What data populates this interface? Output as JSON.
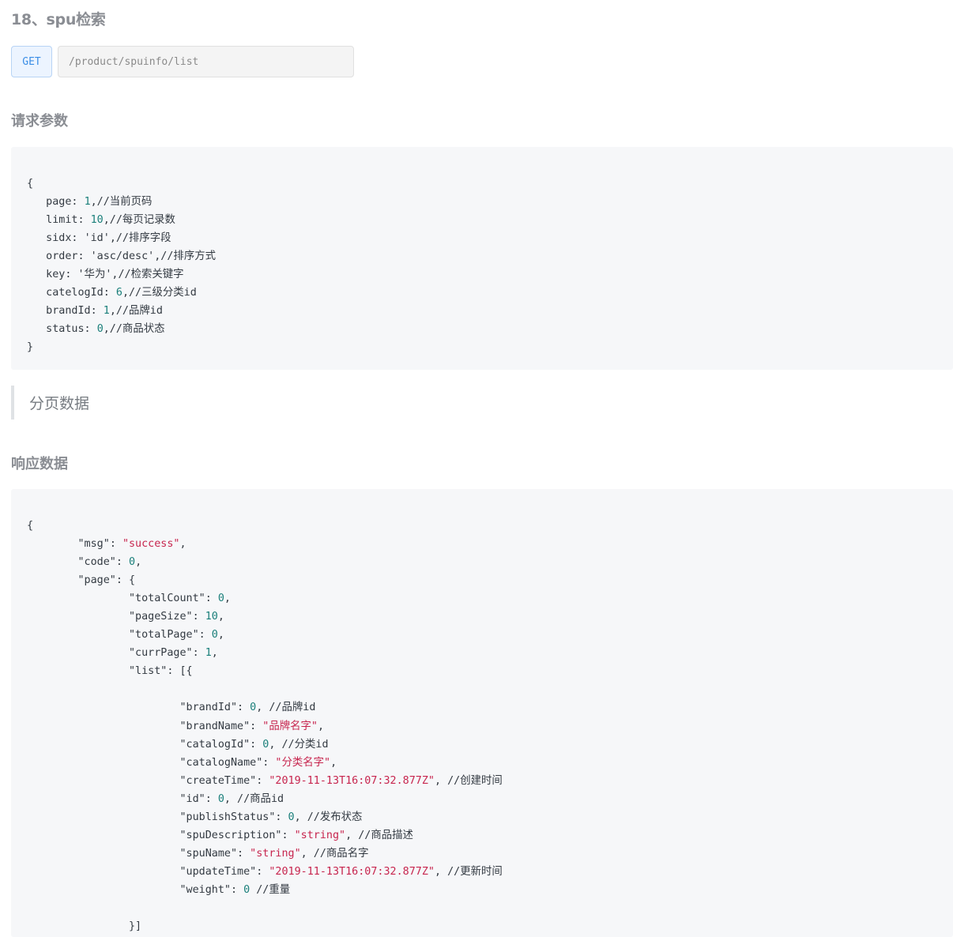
{
  "page_title": "18、spu检索",
  "endpoint": {
    "method": "GET",
    "url": "/product/spuinfo/list"
  },
  "request": {
    "heading": "请求参数",
    "lines": [
      [
        {
          "t": "p",
          "v": "{"
        }
      ],
      [
        {
          "t": "k",
          "v": "   page: "
        },
        {
          "t": "n",
          "v": "1"
        },
        {
          "t": "c",
          "v": ",//当前页码"
        }
      ],
      [
        {
          "t": "k",
          "v": "   limit: "
        },
        {
          "t": "n",
          "v": "10"
        },
        {
          "t": "c",
          "v": ",//每页记录数"
        }
      ],
      [
        {
          "t": "k",
          "v": "   sidx: "
        },
        {
          "t": "k",
          "v": "'id'"
        },
        {
          "t": "c",
          "v": ",//排序字段"
        }
      ],
      [
        {
          "t": "k",
          "v": "   order: "
        },
        {
          "t": "k",
          "v": "'asc/desc'"
        },
        {
          "t": "c",
          "v": ",//排序方式"
        }
      ],
      [
        {
          "t": "k",
          "v": "   key: "
        },
        {
          "t": "k",
          "v": "'华为'"
        },
        {
          "t": "c",
          "v": ",//检索关键字"
        }
      ],
      [
        {
          "t": "k",
          "v": "   catelogId: "
        },
        {
          "t": "n",
          "v": "6"
        },
        {
          "t": "c",
          "v": ",//三级分类id"
        }
      ],
      [
        {
          "t": "k",
          "v": "   brandId: "
        },
        {
          "t": "n",
          "v": "1"
        },
        {
          "t": "c",
          "v": ",//品牌id"
        }
      ],
      [
        {
          "t": "k",
          "v": "   status: "
        },
        {
          "t": "n",
          "v": "0"
        },
        {
          "t": "c",
          "v": ",//商品状态"
        }
      ],
      [
        {
          "t": "p",
          "v": "}"
        }
      ]
    ]
  },
  "note": "分页数据",
  "response": {
    "heading": "响应数据",
    "lines": [
      [
        {
          "t": "p",
          "v": "{"
        }
      ],
      [
        {
          "t": "k",
          "v": "\t\"msg\""
        },
        {
          "t": "p",
          "v": ": "
        },
        {
          "t": "s",
          "v": "\"success\""
        },
        {
          "t": "p",
          "v": ","
        }
      ],
      [
        {
          "t": "k",
          "v": "\t\"code\""
        },
        {
          "t": "p",
          "v": ": "
        },
        {
          "t": "n",
          "v": "0"
        },
        {
          "t": "p",
          "v": ","
        }
      ],
      [
        {
          "t": "k",
          "v": "\t\"page\""
        },
        {
          "t": "p",
          "v": ": {"
        }
      ],
      [
        {
          "t": "k",
          "v": "\t\t\"totalCount\""
        },
        {
          "t": "p",
          "v": ": "
        },
        {
          "t": "n",
          "v": "0"
        },
        {
          "t": "p",
          "v": ","
        }
      ],
      [
        {
          "t": "k",
          "v": "\t\t\"pageSize\""
        },
        {
          "t": "p",
          "v": ": "
        },
        {
          "t": "n",
          "v": "10"
        },
        {
          "t": "p",
          "v": ","
        }
      ],
      [
        {
          "t": "k",
          "v": "\t\t\"totalPage\""
        },
        {
          "t": "p",
          "v": ": "
        },
        {
          "t": "n",
          "v": "0"
        },
        {
          "t": "p",
          "v": ","
        }
      ],
      [
        {
          "t": "k",
          "v": "\t\t\"currPage\""
        },
        {
          "t": "p",
          "v": ": "
        },
        {
          "t": "n",
          "v": "1"
        },
        {
          "t": "p",
          "v": ","
        }
      ],
      [
        {
          "t": "k",
          "v": "\t\t\"list\""
        },
        {
          "t": "p",
          "v": ": [{"
        }
      ],
      [
        {
          "t": "p",
          "v": ""
        }
      ],
      [
        {
          "t": "k",
          "v": "\t\t\t\"brandId\""
        },
        {
          "t": "p",
          "v": ": "
        },
        {
          "t": "n",
          "v": "0"
        },
        {
          "t": "c",
          "v": ", //品牌id"
        }
      ],
      [
        {
          "t": "k",
          "v": "\t\t\t\"brandName\""
        },
        {
          "t": "p",
          "v": ": "
        },
        {
          "t": "s",
          "v": "\"品牌名字\""
        },
        {
          "t": "p",
          "v": ","
        }
      ],
      [
        {
          "t": "k",
          "v": "\t\t\t\"catalogId\""
        },
        {
          "t": "p",
          "v": ": "
        },
        {
          "t": "n",
          "v": "0"
        },
        {
          "t": "c",
          "v": ", //分类id"
        }
      ],
      [
        {
          "t": "k",
          "v": "\t\t\t\"catalogName\""
        },
        {
          "t": "p",
          "v": ": "
        },
        {
          "t": "s",
          "v": "\"分类名字\""
        },
        {
          "t": "p",
          "v": ","
        }
      ],
      [
        {
          "t": "k",
          "v": "\t\t\t\"createTime\""
        },
        {
          "t": "p",
          "v": ": "
        },
        {
          "t": "s",
          "v": "\"2019-11-13T16:07:32.877Z\""
        },
        {
          "t": "c",
          "v": ", //创建时间"
        }
      ],
      [
        {
          "t": "k",
          "v": "\t\t\t\"id\""
        },
        {
          "t": "p",
          "v": ": "
        },
        {
          "t": "n",
          "v": "0"
        },
        {
          "t": "c",
          "v": ", //商品id"
        }
      ],
      [
        {
          "t": "k",
          "v": "\t\t\t\"publishStatus\""
        },
        {
          "t": "p",
          "v": ": "
        },
        {
          "t": "n",
          "v": "0"
        },
        {
          "t": "c",
          "v": ", //发布状态"
        }
      ],
      [
        {
          "t": "k",
          "v": "\t\t\t\"spuDescription\""
        },
        {
          "t": "p",
          "v": ": "
        },
        {
          "t": "s",
          "v": "\"string\""
        },
        {
          "t": "c",
          "v": ", //商品描述"
        }
      ],
      [
        {
          "t": "k",
          "v": "\t\t\t\"spuName\""
        },
        {
          "t": "p",
          "v": ": "
        },
        {
          "t": "s",
          "v": "\"string\""
        },
        {
          "t": "c",
          "v": ", //商品名字"
        }
      ],
      [
        {
          "t": "k",
          "v": "\t\t\t\"updateTime\""
        },
        {
          "t": "p",
          "v": ": "
        },
        {
          "t": "s",
          "v": "\"2019-11-13T16:07:32.877Z\""
        },
        {
          "t": "c",
          "v": ", //更新时间"
        }
      ],
      [
        {
          "t": "k",
          "v": "\t\t\t\"weight\""
        },
        {
          "t": "p",
          "v": ": "
        },
        {
          "t": "n",
          "v": "0"
        },
        {
          "t": "c",
          "v": " //重量"
        }
      ],
      [
        {
          "t": "p",
          "v": ""
        }
      ],
      [
        {
          "t": "p",
          "v": "\t\t}]"
        }
      ]
    ]
  }
}
